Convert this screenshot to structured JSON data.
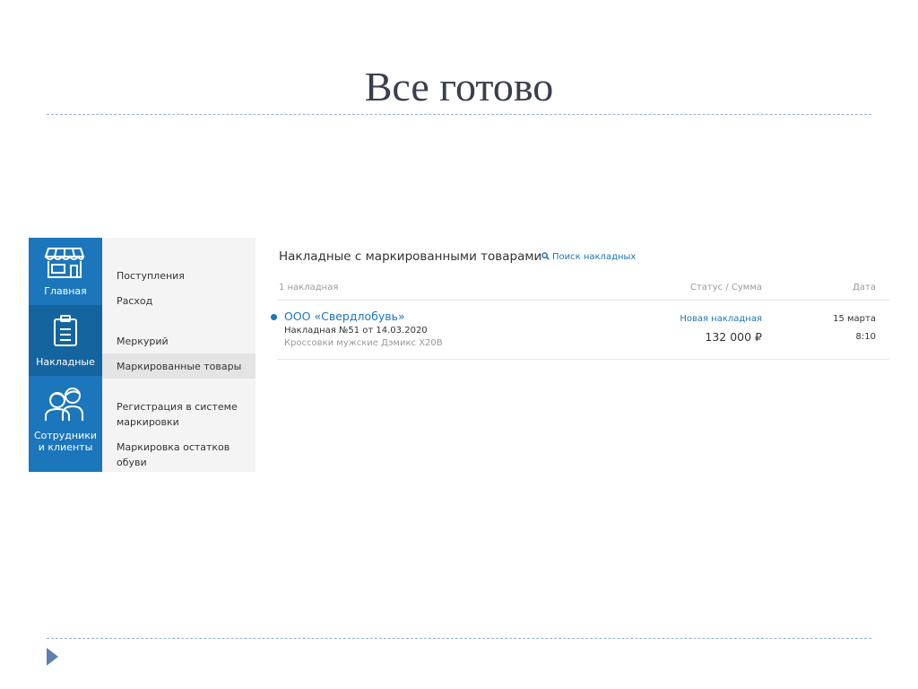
{
  "slide": {
    "title": "Все готово"
  },
  "sidebar": {
    "items": [
      {
        "label": "Главная",
        "icon": "storefront-icon"
      },
      {
        "label": "Накладные",
        "icon": "clipboard-icon"
      },
      {
        "label": "Сотрудники и клиенты",
        "label_line1": "Сотрудники",
        "label_line2": "и клиенты",
        "icon": "people-icon"
      }
    ]
  },
  "subnav": {
    "groups": [
      [
        "Поступления",
        "Расход"
      ],
      [
        "Меркурий",
        "Маркированные товары"
      ],
      [
        "Регистрация в системе маркировки",
        "Маркировка остатков обуви"
      ]
    ],
    "items": {
      "incoming": "Поступления",
      "expense": "Расход",
      "mercury": "Меркурий",
      "marked_goods": "Маркированные товары",
      "registration_line1": "Регистрация в системе",
      "registration_line2": "маркировки",
      "marking_line1": "Маркировка остатков",
      "marking_line2": "обуви"
    },
    "selected": "Маркированные товары"
  },
  "main": {
    "title": "Накладные с маркированными товарами",
    "search_link": "Поиск накладных",
    "count": "1 накладная",
    "col_status": "Статус / Сумма",
    "col_date": "Дата",
    "invoices": [
      {
        "company": "ООО «Свердлобувь»",
        "invoice": "Накладная №51 от 14.03.2020",
        "goods": "Кроссовки мужские Дэмикс X20B",
        "status": "Новая накладная",
        "sum": "132 000 ₽",
        "date": "15 марта",
        "time": "8:10"
      }
    ]
  },
  "colors": {
    "accent": "#1b76bc",
    "accent_active": "#14649f",
    "subnav_bg": "#f4f4f4",
    "selected_bg": "#e4e4e4"
  }
}
